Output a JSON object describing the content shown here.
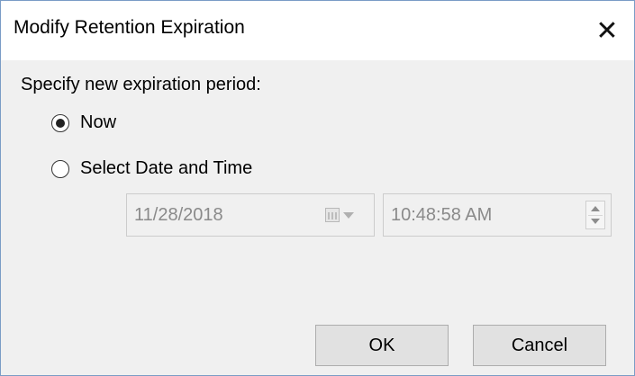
{
  "dialog": {
    "title": "Modify Retention Expiration",
    "close_glyph": "✕",
    "prompt": "Specify new expiration period:",
    "options": [
      {
        "label": "Now",
        "selected": true
      },
      {
        "label": "Select Date and Time",
        "selected": false
      }
    ],
    "date_value": "11/28/2018",
    "time_value": "10:48:58 AM",
    "ok_label": "OK",
    "cancel_label": "Cancel"
  },
  "colors": {
    "window_border": "#7a9cc6",
    "dialog_bg": "#f0f0f0",
    "disabled_text": "#8a8a8a",
    "button_bg": "#e1e1e1"
  },
  "icons": [
    "close-icon",
    "calendar-icon",
    "chevron-down-icon",
    "spin-up-icon",
    "spin-down-icon"
  ]
}
